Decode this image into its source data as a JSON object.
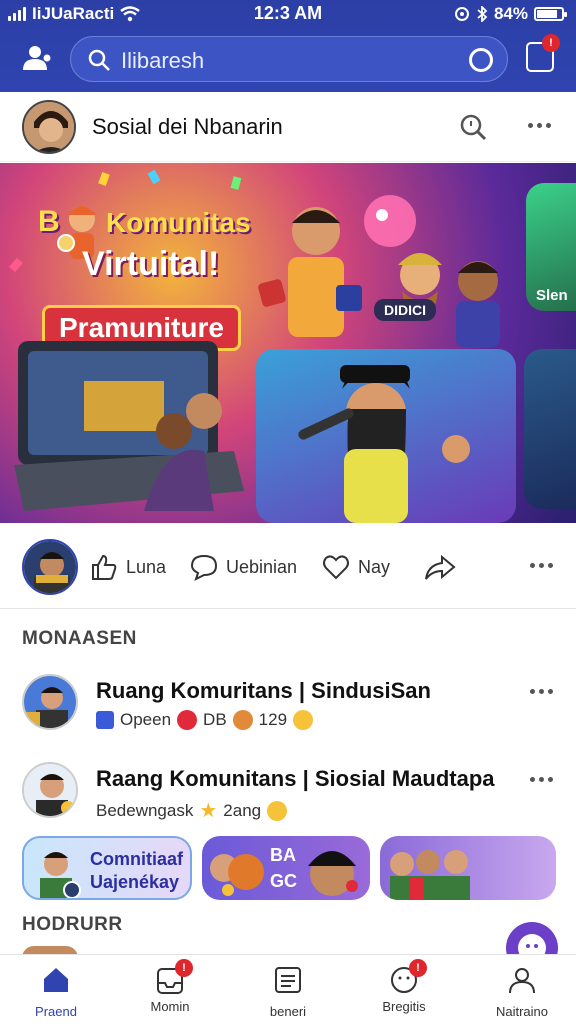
{
  "status_bar": {
    "carrier": "IiJUaRacti",
    "time": "12:3 AM",
    "battery": "84%"
  },
  "header": {
    "search_text": "Ilibaresh",
    "notification_badge": "!"
  },
  "channel": {
    "name": "Sosial dei Nbanarin"
  },
  "banner": {
    "title_line1": "Komunitas",
    "title_prefix": "B",
    "title_line2": "Virtuital!",
    "title_line3": "Pramuniture",
    "tag1": "DIDICI",
    "tag2": "Slen"
  },
  "actions": {
    "like": "Luna",
    "comment": "Uebinian",
    "love": "Nay"
  },
  "section1": {
    "title": "MONAASEN",
    "rows": [
      {
        "title": "Ruang Komuritans | SindusiSan",
        "meta_text": "Opeen",
        "count1": "DB",
        "count2": "129"
      },
      {
        "title": "Raang Komunitans | Siosial Maudtapa",
        "meta_text": "Bedewngask",
        "count1": "2ang"
      }
    ]
  },
  "cards": [
    {
      "line1": "Comnitiaaf",
      "line2": "Uajenékay"
    },
    {
      "line1": "BA",
      "line2": "GC"
    },
    {
      "line1": "",
      "line2": ""
    }
  ],
  "section2": {
    "title": "HODRURR"
  },
  "bottom_nav": [
    {
      "label": "Praend",
      "icon": "home-icon",
      "badge": ""
    },
    {
      "label": "Momin",
      "icon": "inbox-icon",
      "badge": "!"
    },
    {
      "label": "beneri",
      "icon": "document-icon",
      "badge": ""
    },
    {
      "label": "Bregitis",
      "icon": "smiley-icon",
      "badge": "!"
    },
    {
      "label": "Naitraino",
      "icon": "person-icon",
      "badge": ""
    }
  ],
  "colors": {
    "header_bg": "#2f44b0",
    "accent": "#2f44b0",
    "badge": "#e0262d",
    "fab": "#6b3fc8"
  }
}
